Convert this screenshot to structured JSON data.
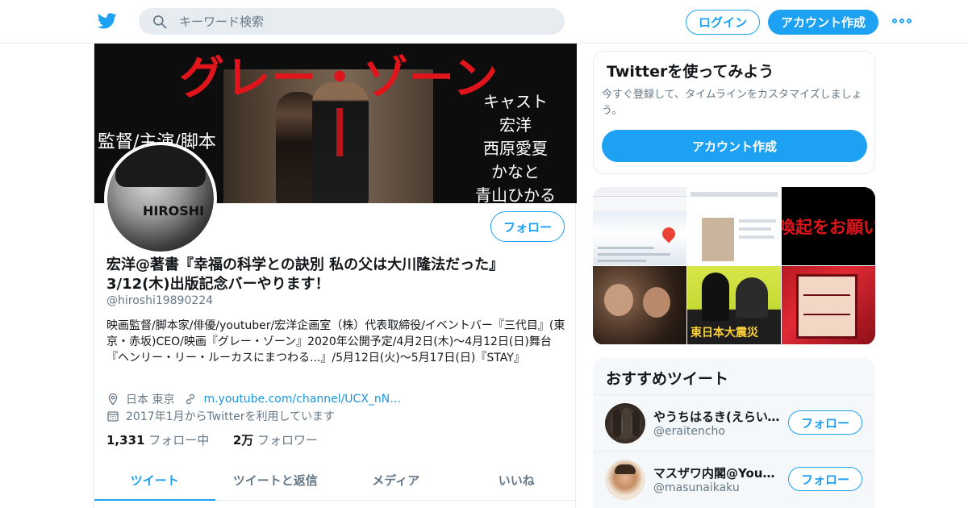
{
  "header": {
    "search_placeholder": "キーワード検索",
    "login_label": "ログイン",
    "signup_label": "アカウント作成"
  },
  "banner": {
    "title": "グレー・ゾーン",
    "left_caption": "監督/主演/脚本",
    "cast_heading": "キャスト",
    "cast": [
      "宏洋",
      "西原愛夏",
      "かなと",
      "青山ひかる"
    ]
  },
  "profile": {
    "avatar_text": "HIROSHI",
    "follow_label": "フォロー",
    "name": "宏洋@著書『幸福の科学との訣別 私の父は大川隆法だった』3/12(木)出版記念バーやります！",
    "handle": "@hiroshi19890224",
    "bio": "映画監督/脚本家/俳優/youtuber/宏洋企画室（株）代表取締役/イベントバー『三代目』(東京・赤坂)CEO/映画『グレー・ゾーン』2020年公開予定/4月2日(木)〜4月12日(日)舞台『ヘンリー・リー・ルーカスにまつわる...』/5月12日(火)〜5月17日(日)『STAY』",
    "location": "日本 東京",
    "url": "m.youtube.com/channel/UCX_nN…",
    "joined": "2017年1月からTwitterを利用しています",
    "following_count": "1,331",
    "following_label": "フォロー中",
    "followers_count": "2万",
    "followers_label": "フォロワー"
  },
  "tabs": [
    {
      "label": "ツイート"
    },
    {
      "label": "ツイートと返信"
    },
    {
      "label": "メディア"
    },
    {
      "label": "いいね"
    }
  ],
  "signup_card": {
    "title": "Twitterを使ってみよう",
    "text": "今すぐ登録して、タイムラインをカスタマイズしましょう。",
    "button_label": "アカウント作成"
  },
  "media": {
    "tile3_text": "喚起をお願いし",
    "tile5_text": "東日本大震災"
  },
  "recommendations": {
    "title": "おすすめツイート",
    "items": [
      {
        "name": "やうちはるき(えらいて…",
        "handle": "@eraitencho",
        "follow_label": "フォロー"
      },
      {
        "name": "マスザワ内閣@YouT…",
        "handle": "@masunaikaku",
        "follow_label": "フォロー"
      }
    ]
  },
  "colors": {
    "accent": "#1da1f2",
    "banner_red": "#e0141b"
  }
}
